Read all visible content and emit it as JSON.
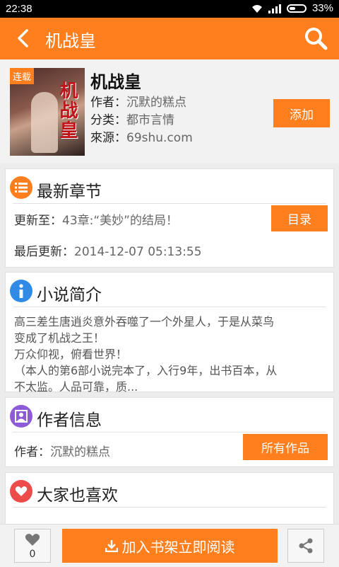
{
  "status": {
    "time": "22:38",
    "battery": "33%"
  },
  "app_bar": {
    "title": "机战皇"
  },
  "book": {
    "cover_ribbon": "连载",
    "cover_title": "机战皇",
    "name": "机战皇",
    "author_label": "作者：",
    "author": "沉默的糕点",
    "category_label": "分类：",
    "category": "都市言情",
    "source_label": "來源：",
    "source": "69shu.com",
    "add_label": "添加"
  },
  "latest": {
    "title": "最新章节",
    "update_label": "更新至：",
    "update_value": "43章:“美妙”的结局！",
    "catalog_label": "目录",
    "last_label": "最后更新：",
    "last_value": "2014-12-07 05:13:55"
  },
  "intro": {
    "title": "小说简介",
    "lines": [
      "高三差生唐逍炎意外吞噬了一个外星人，于是从菜鸟",
      "变成了机战之王！",
      "万众仰视，俯看世界！",
      "（本人的第6部小说完本了，入行9年，出书百本，从",
      "不太监。人品可靠，质..."
    ]
  },
  "author_info": {
    "title": "作者信息",
    "author_label": "作者：",
    "author": "沉默的糕点",
    "all_works_label": "所有作品"
  },
  "also_like": {
    "title": "大家也喜欢"
  },
  "bottom": {
    "like_count": "0",
    "read_label": "加入书架立即阅读"
  },
  "colors": {
    "accent": "#ff7e1d",
    "info_blue": "#2f8be6",
    "user_purple": "#8e5bd8",
    "heart_red": "#ee4b4b"
  }
}
